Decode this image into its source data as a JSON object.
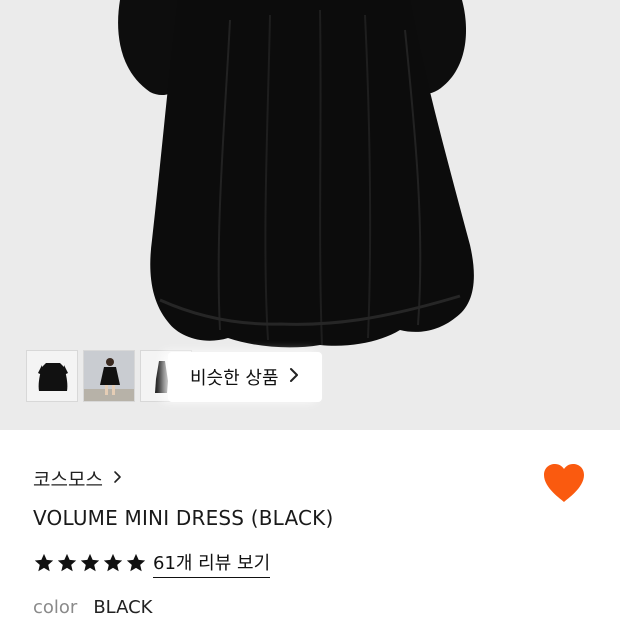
{
  "product_image": {
    "similar_button_label": "비슷한 상품",
    "similar_chevron_icon": "chevron-right-icon",
    "thumbnails": [
      {
        "name": "thumbnail-dress-front"
      },
      {
        "name": "thumbnail-model"
      },
      {
        "name": "thumbnail-dress-side"
      }
    ]
  },
  "product": {
    "brand": "코스모스",
    "brand_chevron_icon": "chevron-right-icon",
    "title": "VOLUME MINI DRESS (BLACK)",
    "rating_stars": 5,
    "review_link": "61개 리뷰 보기",
    "color_label": "color",
    "color_value": "BLACK",
    "wishlist_icon": "heart-icon",
    "wishlist_color": "#fa5a0f"
  }
}
